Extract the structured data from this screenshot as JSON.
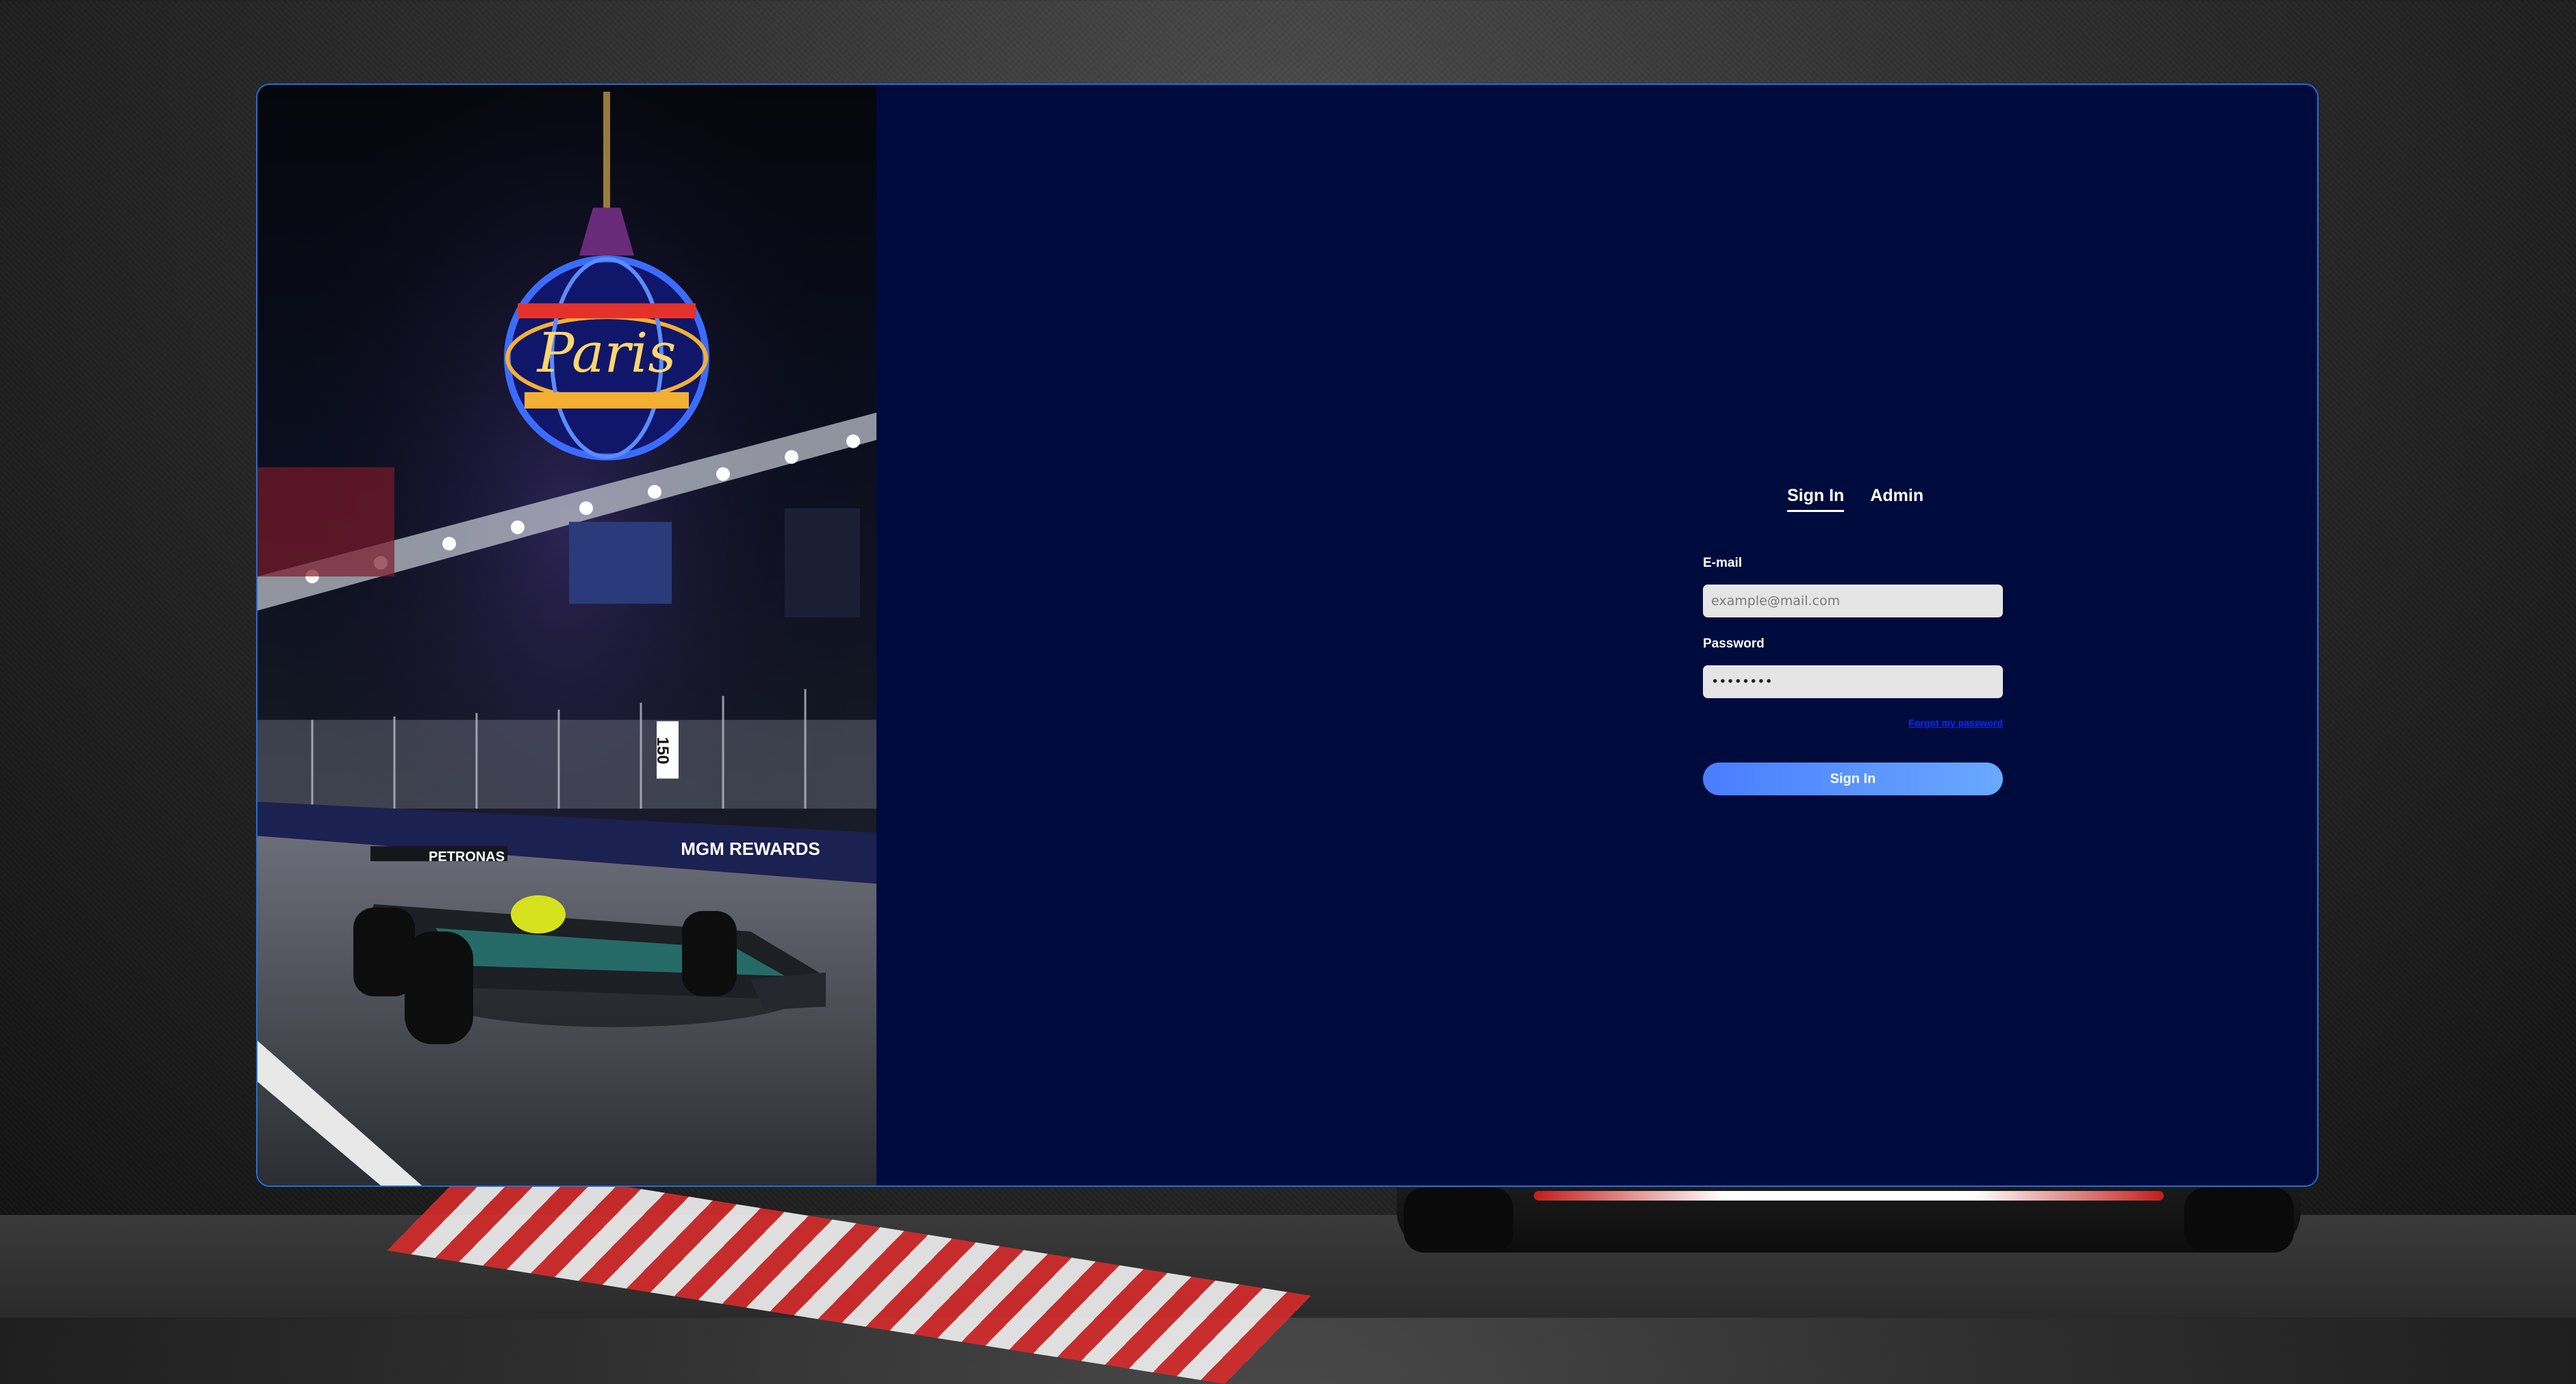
{
  "tabs": [
    {
      "label": "Sign In",
      "active": true
    },
    {
      "label": "Admin",
      "active": false
    }
  ],
  "form": {
    "email_label": "E-mail",
    "email_placeholder": "example@mail.com",
    "password_label": "Password",
    "password_value": "••••••••",
    "forgot_link": "Forgot my password",
    "submit_label": "Sign In"
  },
  "photo": {
    "sign_paris": "Paris",
    "marker_number": "150",
    "banner_text": "MGM REWARDS",
    "car_sponsor": "PETRONAS"
  },
  "colors": {
    "panel_bg": "#000b3d",
    "frame_border": "#1e6fe0",
    "button_start": "#4a7dff",
    "button_end": "#69a9ff",
    "link": "#0030ff"
  }
}
